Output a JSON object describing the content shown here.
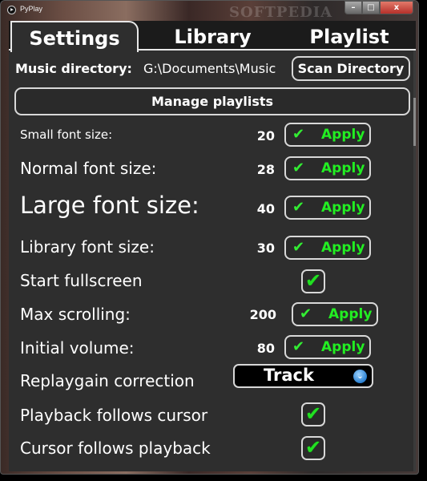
{
  "window": {
    "title": "PyPlay",
    "watermark": "SOFTPEDIA",
    "controls": {
      "minimize": "–",
      "maximize": "□",
      "close": "x"
    }
  },
  "tabs": [
    {
      "label": "Settings",
      "active": true
    },
    {
      "label": "Library",
      "active": false
    },
    {
      "label": "Playlist",
      "active": false
    }
  ],
  "music_directory": {
    "label": "Music directory:",
    "value": "G:\\Documents\\Music",
    "scan_button": "Scan Directory"
  },
  "manage_playlists_button": "Manage playlists",
  "icons": {
    "check": "✔",
    "dropdown": "⌄"
  },
  "colors": {
    "accent_green": "#22ee22",
    "background": "#2e2e2e",
    "tabbar": "#1b1b1b",
    "combo_arrow": "#2a7fd0"
  },
  "settings": [
    {
      "label": "Small font size:",
      "value": "20",
      "button": "Apply"
    },
    {
      "label": "Normal font size:",
      "value": "28",
      "button": "Apply"
    },
    {
      "label": "Large font size:",
      "value": "40",
      "button": "Apply"
    },
    {
      "label": "Library font size:",
      "value": "30",
      "button": "Apply"
    },
    {
      "label": "Start fullscreen",
      "checked": true
    },
    {
      "label": "Max scrolling:",
      "value": "200",
      "button": "Apply"
    },
    {
      "label": "Initial volume:",
      "value": "80",
      "button": "Apply"
    },
    {
      "label": "Replaygain correction",
      "selected": "Track"
    },
    {
      "label": "Playback follows cursor",
      "checked": true
    },
    {
      "label": "Cursor follows playback",
      "checked": true
    }
  ]
}
